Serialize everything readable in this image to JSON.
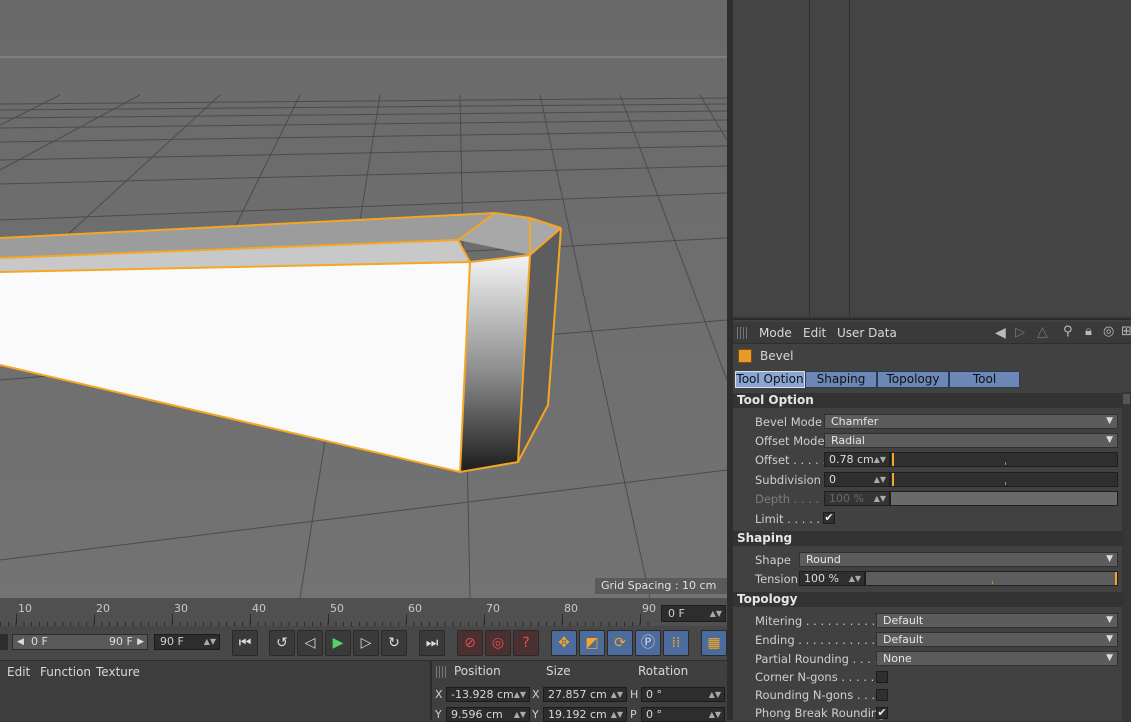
{
  "viewport": {
    "grid_spacing": "Grid Spacing : 10 cm"
  },
  "attributes": {
    "menu": [
      "Mode",
      "Edit",
      "User Data"
    ],
    "object_name": "Bevel",
    "tabs": [
      "Tool Option",
      "Shaping",
      "Topology",
      "Tool"
    ],
    "active_tab": "Tool Option",
    "sections": {
      "tool_option": {
        "title": "Tool Option",
        "bevel_mode_label": "Bevel Mode",
        "bevel_mode_value": "Chamfer",
        "offset_mode_label": "Offset Mode",
        "offset_mode_value": "Radial",
        "offset_label": "Offset . . . . .",
        "offset_value": "0.78 cm",
        "subdivision_label": "Subdivision",
        "subdivision_value": "0",
        "depth_label": "Depth . . . . .",
        "depth_value": "100 %",
        "limit_label": "Limit . . . . . .",
        "limit_checked": "✔"
      },
      "shaping": {
        "title": "Shaping",
        "shape_label": "Shape",
        "shape_value": "Round",
        "tension_label": "Tension",
        "tension_value": "100 %"
      },
      "topology": {
        "title": "Topology",
        "mitering_label": "Mitering . . . . . . . . . . . .",
        "mitering_value": "Default",
        "ending_label": "Ending . . . . . . . . . . . . .",
        "ending_value": "Default",
        "partial_rounding_label": "Partial Rounding . . . . .",
        "partial_rounding_value": "None",
        "corner_ngons_label": "Corner N-gons . . . . . .",
        "rounding_ngons_label": "Rounding N-gons . . . .",
        "phong_break_label": "Phong Break Rounding",
        "phong_break_checked": "✔"
      }
    }
  },
  "timeline": {
    "ticks": [
      "10",
      "20",
      "30",
      "40",
      "50",
      "60",
      "70",
      "80",
      "90"
    ],
    "current_frame": "0 F",
    "range_start": "0 F",
    "range_end": "90 F",
    "max_frame": "90 F"
  },
  "material_menu": [
    "Edit",
    "Function",
    "Texture"
  ],
  "coordinates": {
    "headers": [
      "Position",
      "Size",
      "Rotation"
    ],
    "rows": [
      {
        "axis": "X",
        "pos": "-13.928 cm",
        "size_axis": "X",
        "size": "27.857 cm",
        "rot_axis": "H",
        "rot": "0 °"
      },
      {
        "axis": "Y",
        "pos": "9.596 cm",
        "size_axis": "Y",
        "size": "19.192 cm",
        "rot_axis": "P",
        "rot": "0 °"
      }
    ]
  },
  "colors": {
    "accent": "#f5a623",
    "tab_blue": "#6b87b5",
    "viewport_bg": "#6e6e6e"
  }
}
